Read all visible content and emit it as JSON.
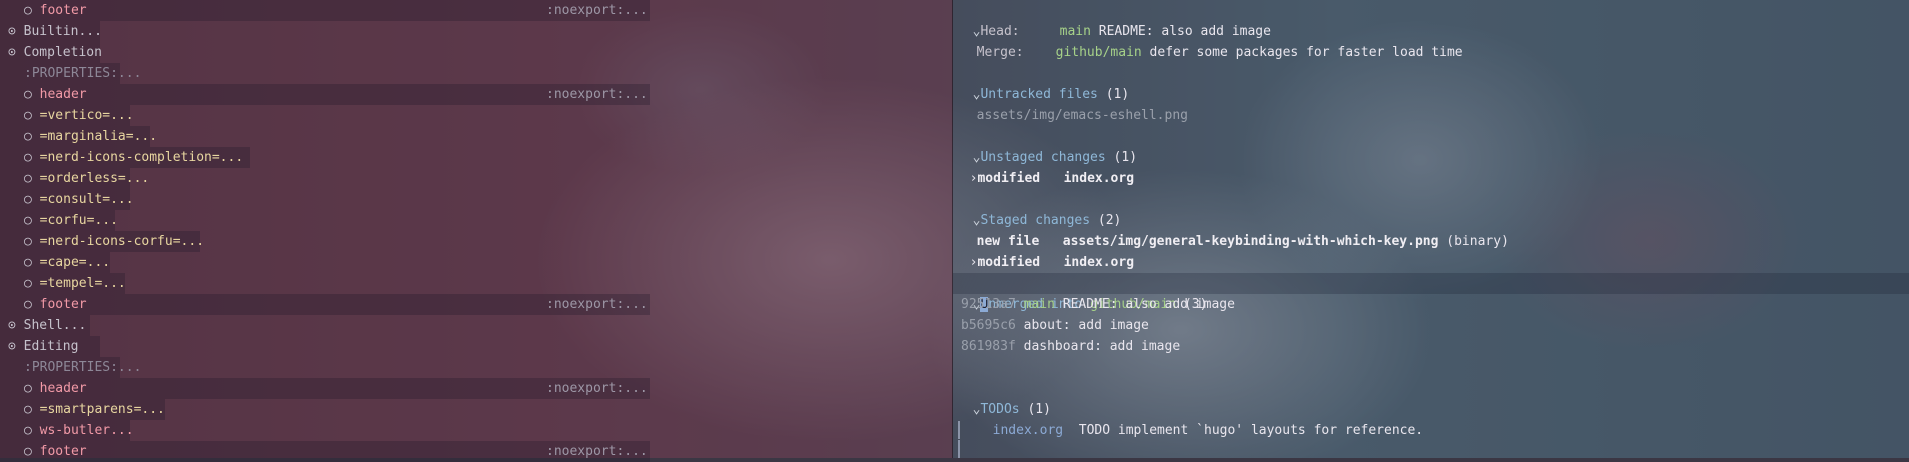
{
  "left_pane": {
    "rows": [
      {
        "bullet": "○",
        "text": "footer",
        "tag": ":noexport:...",
        "style": "pink"
      },
      {
        "bullet": "⊙",
        "text": "Builtin...",
        "tag": "",
        "style": "grey"
      },
      {
        "bullet": "⊙",
        "text": "Completion",
        "tag": "",
        "style": "grey"
      },
      {
        "bullet": "",
        "text": ":PROPERTIES:...",
        "tag": "",
        "style": "dim"
      },
      {
        "bullet": "○",
        "text": "header",
        "tag": ":noexport:...",
        "style": "pink"
      },
      {
        "bullet": "○",
        "text": "=vertico=...",
        "tag": "",
        "style": "yellow"
      },
      {
        "bullet": "○",
        "text": "=marginalia=...",
        "tag": "",
        "style": "yellow"
      },
      {
        "bullet": "○",
        "text": "=nerd-icons-completion=...",
        "tag": "",
        "style": "yellow"
      },
      {
        "bullet": "○",
        "text": "=orderless=...",
        "tag": "",
        "style": "yellow"
      },
      {
        "bullet": "○",
        "text": "=consult=...",
        "tag": "",
        "style": "yellow"
      },
      {
        "bullet": "○",
        "text": "=corfu=...",
        "tag": "",
        "style": "yellow"
      },
      {
        "bullet": "○",
        "text": "=nerd-icons-corfu=...",
        "tag": "",
        "style": "yellow"
      },
      {
        "bullet": "○",
        "text": "=cape=...",
        "tag": "",
        "style": "yellow"
      },
      {
        "bullet": "○",
        "text": "=tempel=...",
        "tag": "",
        "style": "yellow"
      },
      {
        "bullet": "○",
        "text": "footer",
        "tag": ":noexport:...",
        "style": "pink"
      },
      {
        "bullet": "⊙",
        "text": "Shell...",
        "tag": "",
        "style": "grey"
      },
      {
        "bullet": "⊙",
        "text": "Editing",
        "tag": "",
        "style": "grey"
      },
      {
        "bullet": "",
        "text": ":PROPERTIES:...",
        "tag": "",
        "style": "dim"
      },
      {
        "bullet": "○",
        "text": "header",
        "tag": ":noexport:...",
        "style": "pink"
      },
      {
        "bullet": "○",
        "text": "=smartparens=...",
        "tag": "",
        "style": "yellow"
      },
      {
        "bullet": "○",
        "text": "ws-butler...",
        "tag": "",
        "style": "pink"
      },
      {
        "bullet": "○",
        "text": "footer",
        "tag": ":noexport:...",
        "style": "pink"
      }
    ]
  },
  "magit": {
    "head_label": "Head:",
    "head_branch": "main",
    "head_msg": "README: also add image",
    "merge_label": "Merge:",
    "merge_branch": "github/main",
    "merge_msg": "defer some packages for faster load time",
    "untracked_title": "Untracked files",
    "untracked_count": "(1)",
    "untracked_file": "assets/img/emacs-eshell.png",
    "unstaged_title": "Unstaged changes",
    "unstaged_count": "(1)",
    "unstaged_kind": "modified",
    "unstaged_file": "index.org",
    "staged_title": "Staged changes",
    "staged_count": "(2)",
    "staged_new_kind": "new file",
    "staged_new_file": "assets/img/general-keybinding-with-which-key.png",
    "staged_new_note": "(binary)",
    "staged_mod_kind": "modified",
    "staged_mod_file": "index.org",
    "unmerged_cursor": "U",
    "unmerged_title": "nmerged into",
    "unmerged_branch": "github/main",
    "unmerged_count": "(3)",
    "commits": [
      {
        "hash": "92513a7",
        "ref": "main",
        "msg": "README: also add image"
      },
      {
        "hash": "b5695c6",
        "ref": "",
        "msg": "about: add image"
      },
      {
        "hash": "861983f",
        "ref": "",
        "msg": "dashboard: add image"
      }
    ],
    "todos_title": "TODOs",
    "todos_count": "(1)",
    "todo_file": "index.org",
    "todo_text": "TODO implement `hugo' layouts for reference."
  },
  "icons": {
    "expanded": "⌄",
    "collapsed": "›",
    "bullet_open": "○",
    "bullet_folded": "⊙"
  }
}
